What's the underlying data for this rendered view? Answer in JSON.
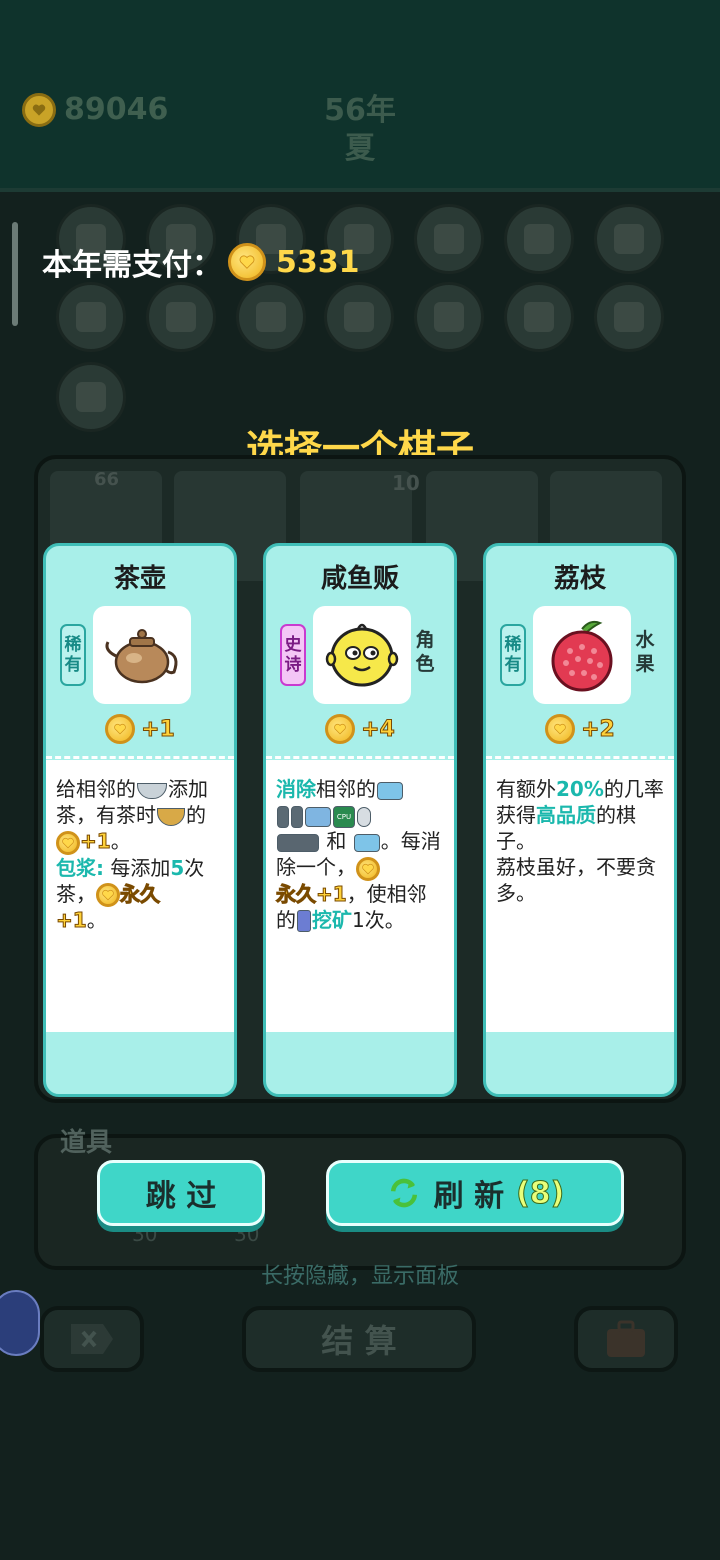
{
  "header": {
    "coins": "89046",
    "year": "56年",
    "season": "夏"
  },
  "payment": {
    "label": "本年需支付：",
    "amount": "5331"
  },
  "title": "选择一个棋子",
  "cards": [
    {
      "name": "茶壶",
      "rarity": [
        "稀",
        "有"
      ],
      "category": [
        "",
        ""
      ],
      "gain": "+1",
      "desc": {
        "p1": "给相邻的",
        "p2": "添加茶，有茶时",
        "p3": "的",
        "p4": "+1",
        "p5": "。",
        "p6": "包浆:",
        "p7": " 每添加",
        "p8": "5",
        "p9": "次茶，",
        "p10": "永久",
        "p11": "+1",
        "p12": "。"
      }
    },
    {
      "name": "咸鱼贩",
      "rarity": [
        "史",
        "诗"
      ],
      "category": [
        "角",
        "色"
      ],
      "gain": "+4",
      "desc": {
        "p1": "消除",
        "p2": "相邻的",
        "p3": "和",
        "p4": "。每消除一个，",
        "p5": "永久+1",
        "p6": "，使相邻的",
        "p7": "挖矿",
        "p8": "1次。",
        "cpu": "CPU"
      }
    },
    {
      "name": "荔枝",
      "rarity": [
        "稀",
        "有"
      ],
      "category": [
        "水",
        "果"
      ],
      "gain": "+2",
      "desc": {
        "p1": "有额外",
        "p2": "20%",
        "p3": "的几率获得",
        "p4": "高品质",
        "p5": "的棋子。",
        "p6": "荔枝虽好，不要贪多。"
      }
    }
  ],
  "buttons": {
    "skip": "跳 过",
    "refresh": "刷 新",
    "refresh_count": "(8)"
  },
  "hint": "长按隐藏，显示面板",
  "props": {
    "title": "道具",
    "n1": "30",
    "n2": "30"
  },
  "bottom": {
    "settle": "结 算"
  },
  "board_numbers": {
    "a": "66",
    "b": "10"
  },
  "colors": {
    "card_bg": "#a8efe9",
    "accent_cyan": "#3fd6c8",
    "gold": "#ffd84a"
  }
}
